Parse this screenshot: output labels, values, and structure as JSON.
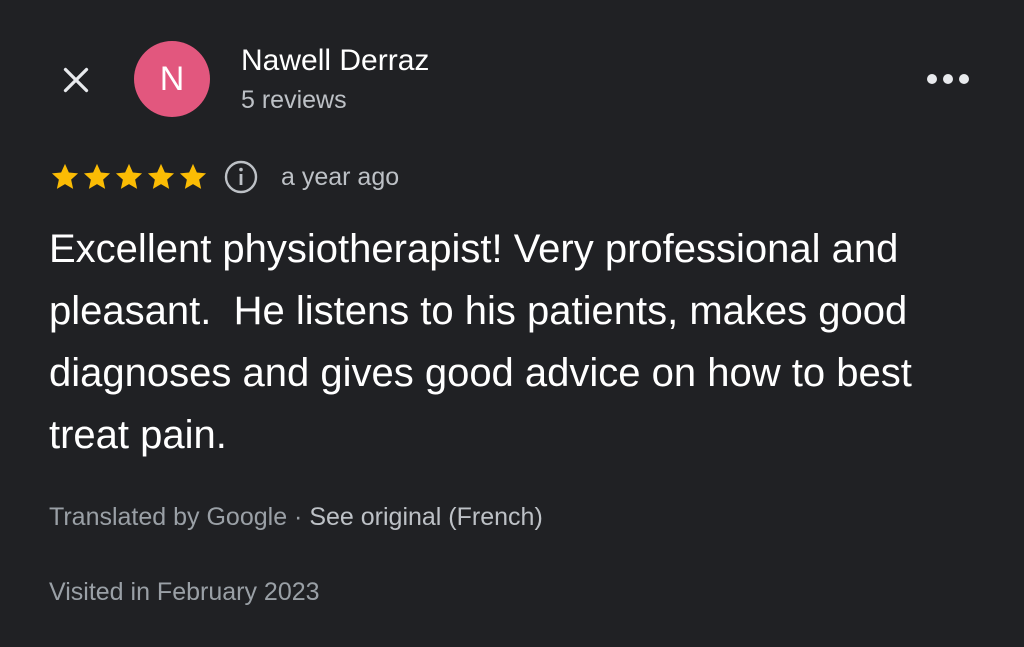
{
  "header": {
    "close_icon": "close-icon",
    "more_icon": "more-horizontal-icon"
  },
  "reviewer": {
    "initial": "N",
    "avatar_color": "#e2577e",
    "name": "Nawell Derraz",
    "review_count": "5 reviews"
  },
  "review": {
    "rating": 5,
    "max_rating": 5,
    "star_color": "#fbbc04",
    "info_icon": "info-icon",
    "date": "a year ago",
    "text": "Excellent physiotherapist! Very professional and pleasant.  He listens to his patients, makes good diagnoses and gives good advice on how to best treat pain.",
    "translated_by": "Translated by Google",
    "separator": " · ",
    "see_original": "See original (French)",
    "visited": "Visited in February 2023"
  }
}
